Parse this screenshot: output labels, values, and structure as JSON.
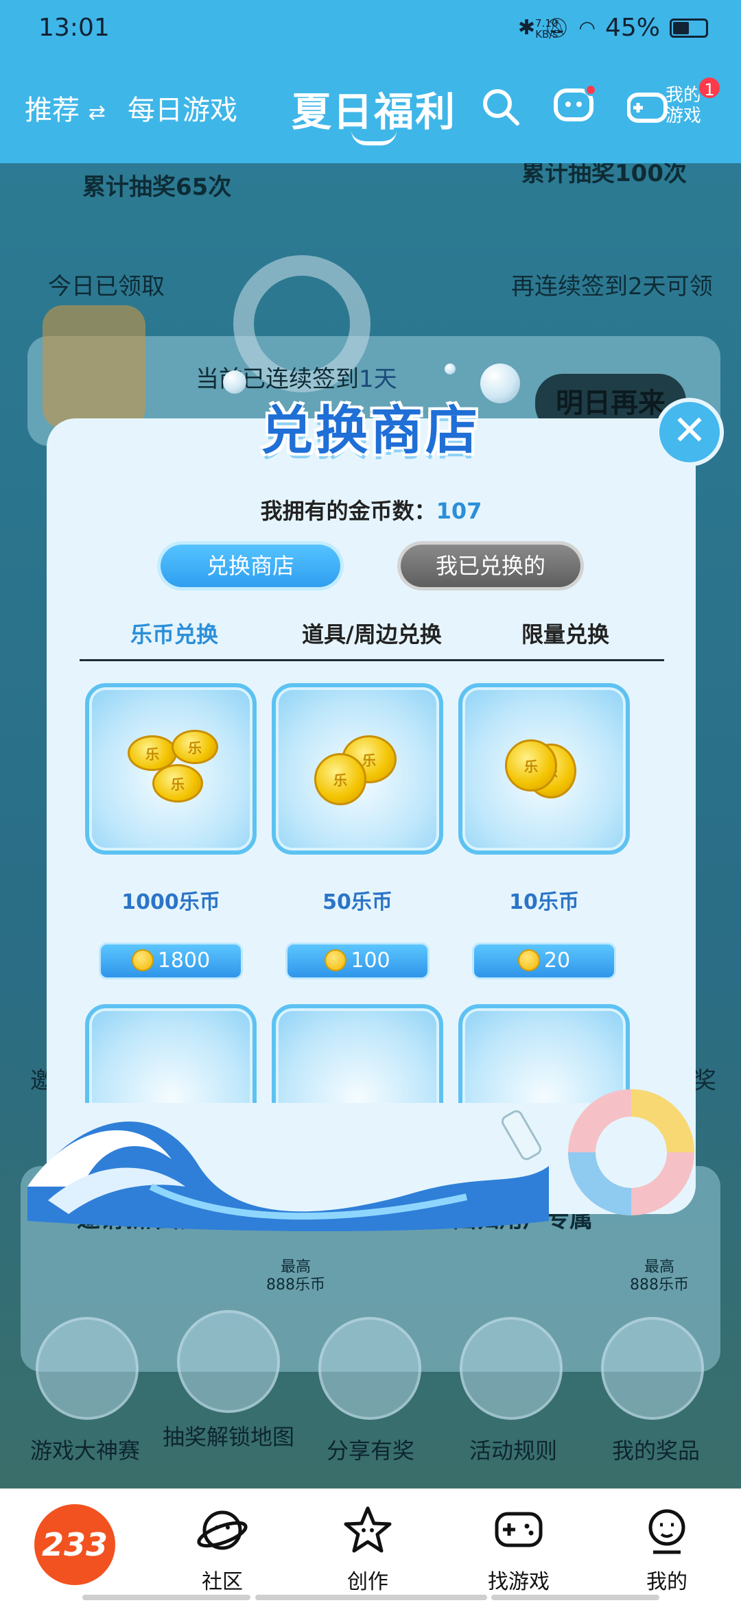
{
  "status_bar": {
    "time": "13:01",
    "netspeed": "7.10\nKB/s",
    "battery": "45%",
    "battery_level": 0.45
  },
  "nav": {
    "tab_recommend": "推荐",
    "swap_glyph": "⇄",
    "tab_daily": "每日游戏",
    "title": "夏日福利",
    "my_games_label": "我的\n游戏",
    "my_games_badge": "1"
  },
  "background_page": {
    "total_draws_65": "累计抽奖65次",
    "total_draws_100": "累计抽奖100次",
    "today_claimed": "今日已领取",
    "streak_hint": "再连续签到2天可领",
    "streak_text": "当前已连续签到",
    "streak_days": "1天",
    "come_tomorrow": "明日再来",
    "invite_new": "邀请新/回归用户礼包",
    "returning_exclusive": "回归用户专属",
    "max_label": "最高",
    "max_amount": "888乐币",
    "side_left": "邀",
    "side_right": "奖",
    "icons": [
      {
        "label": "游戏大神赛"
      },
      {
        "label": "抽奖解锁地图"
      },
      {
        "label": "分享有奖"
      },
      {
        "label": "活动规则"
      },
      {
        "label": "我的奖品"
      }
    ]
  },
  "modal": {
    "title": "兑换商店",
    "close_glyph": "✕",
    "coins_label": "我拥有的金币数：",
    "coins_value": "107",
    "toggle_active": "兑换商店",
    "toggle_inactive": "我已兑换的",
    "subtabs": [
      "乐币兑换",
      "道具/周边兑换",
      "限量兑换"
    ],
    "items": [
      {
        "name": "1000乐币",
        "price": "1800"
      },
      {
        "name": "50乐币",
        "price": "100"
      },
      {
        "name": "10乐币",
        "price": "20"
      }
    ],
    "coin_glyph": "乐"
  },
  "bottom_nav": {
    "logo": "233",
    "items": [
      {
        "label": "社区",
        "icon": "planet-face-icon"
      },
      {
        "label": "创作",
        "icon": "star-face-icon"
      },
      {
        "label": "找游戏",
        "icon": "gamepad-icon"
      },
      {
        "label": "我的",
        "icon": "profile-face-icon"
      }
    ]
  },
  "colors": {
    "header": "#3fb6e8",
    "accent_blue": "#2c8fd8",
    "badge_red": "#ff3b4b",
    "logo_orange": "#f2521f"
  }
}
